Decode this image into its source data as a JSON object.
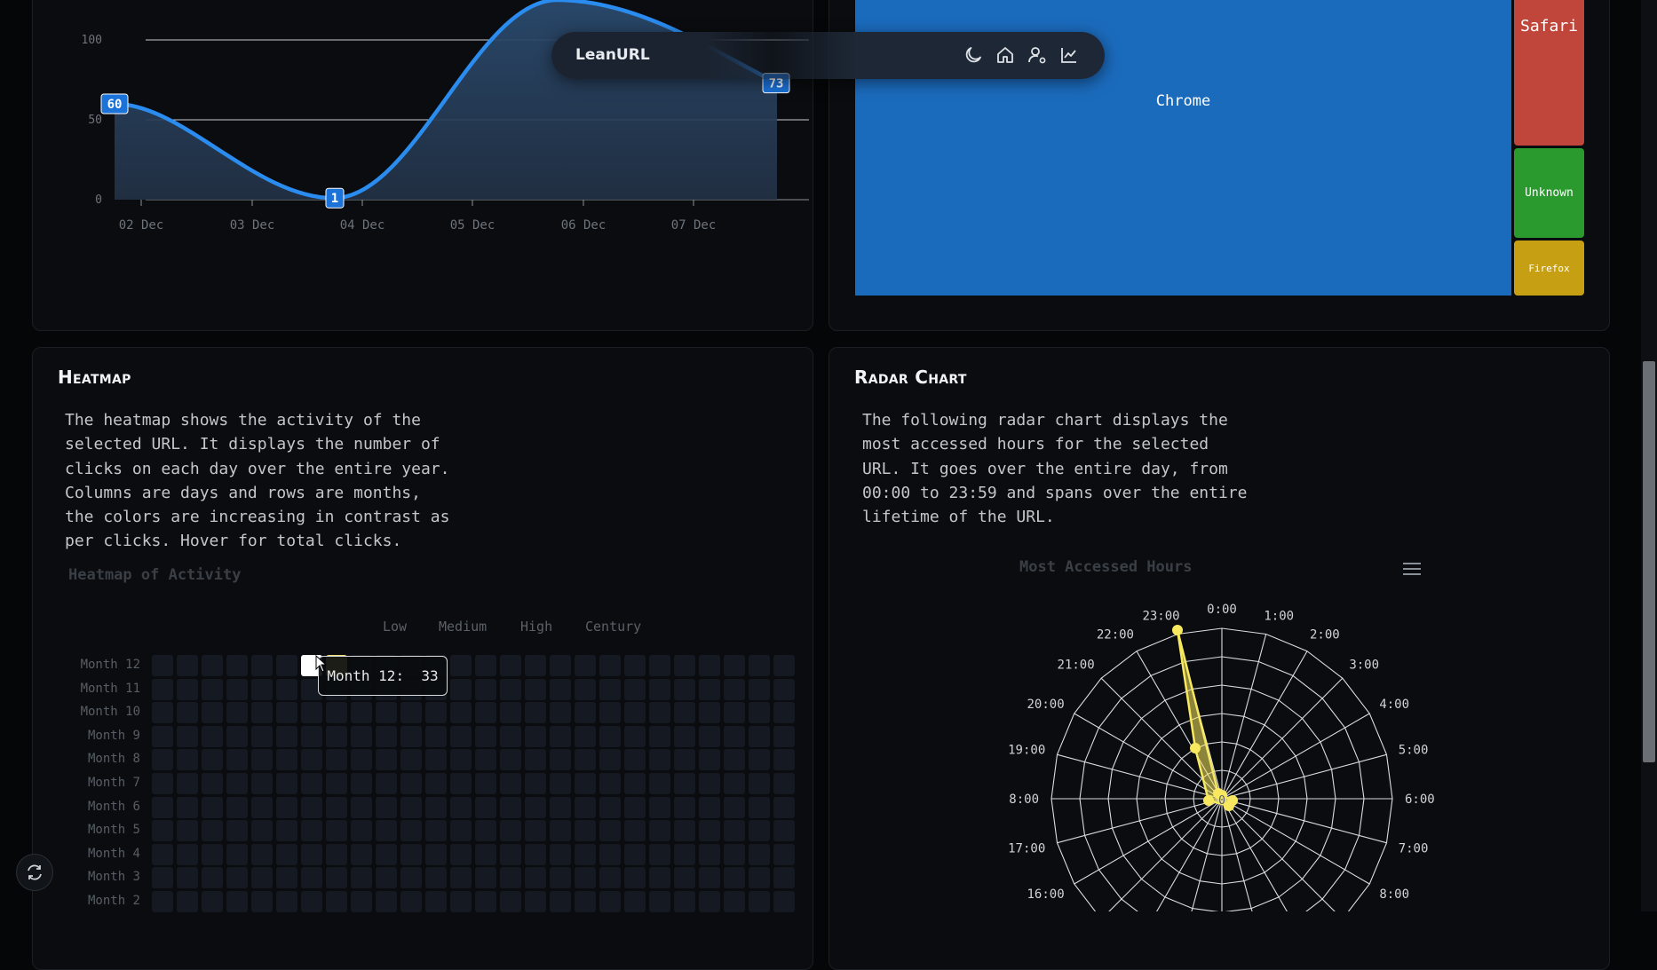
{
  "navbar": {
    "brand": "LeanURL",
    "icons": [
      "moon-icon",
      "home-icon",
      "user-settings-icon",
      "chart-icon"
    ]
  },
  "line_chart": {
    "chart_data": {
      "type": "area",
      "categories": [
        "02 Dec",
        "03 Dec",
        "04 Dec",
        "05 Dec",
        "06 Dec",
        "07 Dec"
      ],
      "y_ticks": [
        "0",
        "50",
        "100"
      ],
      "ylim": [
        0,
        100
      ],
      "data_labels": [
        "60",
        "1",
        "73"
      ],
      "series": [
        {
          "values": [
            60,
            1,
            73
          ]
        }
      ],
      "color": "#2b8cf0"
    }
  },
  "treemap": {
    "chart_data": {
      "type": "treemap",
      "items": [
        {
          "label": "Chrome",
          "color": "#1b6bbd"
        },
        {
          "label": "Safari",
          "color": "#c0453a"
        },
        {
          "label": "Unknown",
          "color": "#2a9a2e"
        },
        {
          "label": "Firefox",
          "color": "#c6a012"
        }
      ]
    }
  },
  "heatmap_section": {
    "title": "Heatmap",
    "description": "The heatmap shows the activity of the\nselected URL. It displays the number of\nclicks on each day over the entire year.\nColumns are days and rows are months,\nthe colors are increasing in contrast as\nper clicks. Hover for total clicks.",
    "chart_title": "Heatmap of Activity",
    "legend": [
      "Low",
      "Medium",
      "High",
      "Century"
    ],
    "rows": [
      "Month 12",
      "Month 11",
      "Month 10",
      "Month 9",
      "Month 8",
      "Month 7",
      "Month 6",
      "Month 5",
      "Month 4",
      "Month 3",
      "Month 2"
    ],
    "tooltip": "Month 12:  33",
    "colors": {
      "empty": "#151a22",
      "active": "#f5e37a"
    }
  },
  "radar_section": {
    "title": "Radar Chart",
    "description": "The following radar chart displays the\nmost accessed hours for the selected\nURL. It goes over the entire day, from\n00:00 to 23:59 and spans over the entire\nlifetime of the URL.",
    "chart_title": "Most Accessed Hours",
    "menu_icon": "hamburger-icon",
    "center_label": "0",
    "chart_data": {
      "type": "radar",
      "hour_labels": [
        "0:00",
        "1:00",
        "2:00",
        "3:00",
        "4:00",
        "5:00",
        "6:00",
        "7:00",
        "8:00",
        "16:00",
        "17:00",
        "8:00",
        "19:00",
        "20:00",
        "21:00",
        "22:00",
        "23:00"
      ],
      "peak_hour": "23:00",
      "color": "#f7e85f"
    }
  },
  "refresh_button": {
    "icon": "refresh-icon"
  }
}
